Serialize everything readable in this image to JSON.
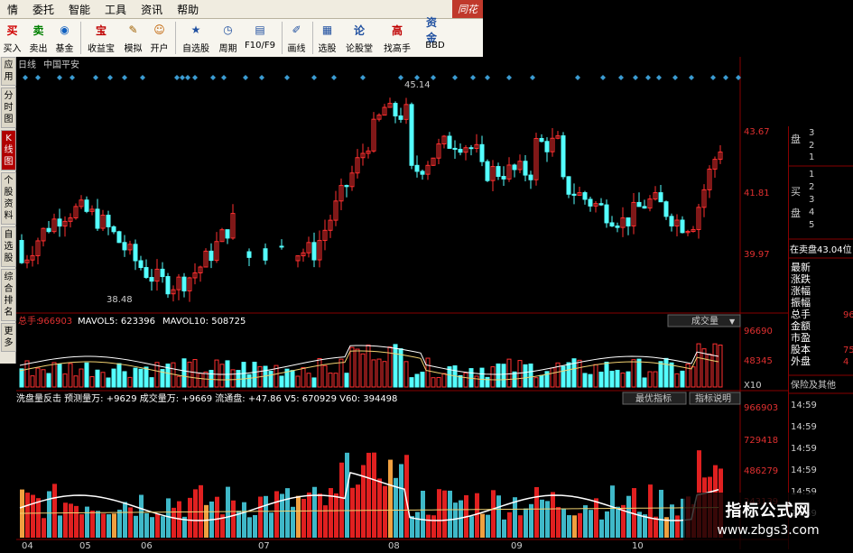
{
  "menu": [
    "情",
    "委托",
    "智能",
    "工具",
    "资讯",
    "帮助"
  ],
  "menu_logo": "同花",
  "toolbar": [
    {
      "label": "买入",
      "icon": "买",
      "color": "#d00000",
      "name": "buy-button"
    },
    {
      "label": "卖出",
      "icon": "卖",
      "color": "#008000",
      "name": "sell-button"
    },
    {
      "label": "基金",
      "icon": "◉",
      "color": "#1060c0",
      "name": "fund-button"
    },
    {
      "label": "收益宝",
      "icon": "宝",
      "color": "#c00000",
      "name": "shouyibao-button"
    },
    {
      "label": "模拟",
      "icon": "✎",
      "color": "#a06000",
      "name": "simulate-button"
    },
    {
      "label": "开户",
      "icon": "☺",
      "color": "#c06000",
      "name": "open-account-button"
    },
    {
      "label": "自选股",
      "icon": "★",
      "color": "#2050a0",
      "name": "watchlist-button"
    },
    {
      "label": "周期",
      "icon": "◷",
      "color": "#2050a0",
      "name": "period-button"
    },
    {
      "label": "F10/F9",
      "icon": "▤",
      "color": "#2050a0",
      "name": "f10-button"
    },
    {
      "label": "画线",
      "icon": "✐",
      "color": "#2050a0",
      "name": "draw-line-button"
    },
    {
      "label": "选股",
      "icon": "▦",
      "color": "#2050a0",
      "name": "stock-pick-button"
    },
    {
      "label": "论股堂",
      "icon": "论",
      "color": "#2050a0",
      "name": "forum-button"
    },
    {
      "label": "找高手",
      "icon": "高",
      "color": "#c00000",
      "name": "expert-button"
    },
    {
      "label": "BBD",
      "icon": "资金",
      "color": "#2050a0",
      "name": "bbd-button"
    }
  ],
  "side_tabs": [
    "应用",
    "分时图",
    "K线图",
    "个股资料",
    "自选股",
    "综合排名",
    "更多"
  ],
  "chart_header": {
    "period": "日线",
    "stock": "中国平安"
  },
  "price_labels": {
    "high": "45.14",
    "low": "38.48"
  },
  "price_axis": [
    "43.67",
    "41.81",
    "39.97"
  ],
  "volume_header": {
    "label": "总手:",
    "value": "966903",
    "ma5": "MAVOL5: 623396",
    "ma10": "MAVOL10: 508725",
    "dropdown": "成交量"
  },
  "volume_axis": [
    "96690",
    "48345",
    "X10"
  ],
  "indicator_header": {
    "text": "洗盘量反击 预测量万: +9629 成交量万: +9669 流通盘: +47.86 V5: 670929 V60: 394498",
    "btn1": "最优指标",
    "btn2": "指标说明"
  },
  "indicator_axis": [
    "966903",
    "729418",
    "486279",
    "243139"
  ],
  "x_axis": [
    "04",
    "05",
    "06",
    "07",
    "08",
    "09",
    "10"
  ],
  "orderbook": {
    "sell_label": "盘",
    "buy_label": "买",
    "buy_label2": "盘",
    "sell_rows": [
      "3",
      "2",
      "1"
    ],
    "buy_rows": [
      "1",
      "2",
      "3",
      "4",
      "5"
    ],
    "outer_sell": "在卖盘43.04位"
  },
  "quote_fields": [
    "最新",
    "涨跌",
    "涨幅",
    "振幅",
    "总手",
    "金额",
    "市盈",
    "股本",
    "外盘"
  ],
  "quote_values": [
    "",
    "",
    "",
    "",
    "96",
    "",
    "",
    "75",
    "4"
  ],
  "bottom_links": "保险及其他",
  "ticks": [
    "14:59",
    "14:59",
    "14:59",
    "14:59",
    "14:59",
    "14:59"
  ],
  "watermark": {
    "line1": "指标公式网",
    "line2": "www.zbgs3.com"
  },
  "chart_data": [
    {
      "type": "candlestick",
      "title": "日线 中国平安",
      "y_range": [
        38.0,
        46.0
      ],
      "annotations": [
        {
          "label": "45.14"
        },
        {
          "label": "38.48"
        }
      ]
    },
    {
      "type": "bar",
      "title": "成交量",
      "series": [
        {
          "name": "MAVOL5"
        },
        {
          "name": "MAVOL10"
        }
      ]
    },
    {
      "type": "bar",
      "title": "洗盘量反击"
    }
  ]
}
